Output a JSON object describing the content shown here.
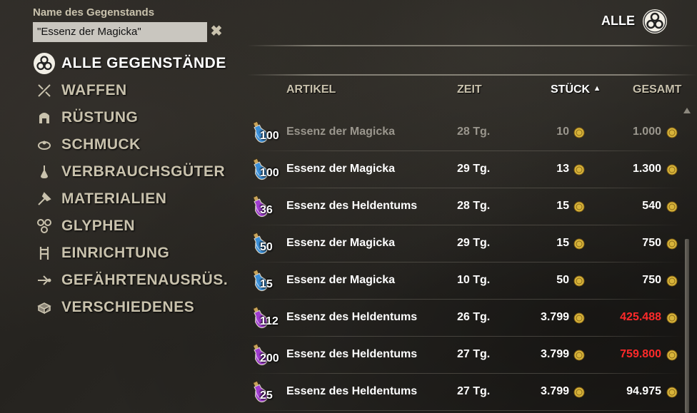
{
  "search": {
    "label": "Name des Gegenstands",
    "value": "\"Essenz der Magicka\"",
    "clear_icon": "close-icon"
  },
  "categories": [
    {
      "label": "ALLE GEGENSTÄNDE",
      "icon": "all-items-icon",
      "active": true
    },
    {
      "label": "WAFFEN",
      "icon": "weapons-icon"
    },
    {
      "label": "RÜSTUNG",
      "icon": "armor-icon"
    },
    {
      "label": "SCHMUCK",
      "icon": "jewelry-icon"
    },
    {
      "label": "VERBRAUCHSGÜTER",
      "icon": "consumables-icon"
    },
    {
      "label": "MATERIALIEN",
      "icon": "materials-icon"
    },
    {
      "label": "GLYPHEN",
      "icon": "glyphs-icon"
    },
    {
      "label": "EINRICHTUNG",
      "icon": "furnishing-icon"
    },
    {
      "label": "GEFÄHRTENAUSRÜS.",
      "icon": "companion-gear-icon"
    },
    {
      "label": "VERSCHIEDENES",
      "icon": "misc-icon"
    }
  ],
  "filter": {
    "label": "ALLE",
    "icon": "all-filter-icon"
  },
  "columns": {
    "item": "ARTIKEL",
    "time": "ZEIT",
    "unit": "STÜCK",
    "unit_sort": "▲",
    "total": "GESAMT"
  },
  "listings": [
    {
      "qty": "100",
      "name": "Essenz der Magicka",
      "time": "28 Tg.",
      "unit": "10",
      "total": "1.000",
      "potion": "blue",
      "dim": true
    },
    {
      "qty": "100",
      "name": "Essenz der Magicka",
      "time": "29 Tg.",
      "unit": "13",
      "total": "1.300",
      "potion": "blue"
    },
    {
      "qty": "36",
      "name": "Essenz des Heldentums",
      "time": "28 Tg.",
      "unit": "15",
      "total": "540",
      "potion": "purple"
    },
    {
      "qty": "50",
      "name": "Essenz der Magicka",
      "time": "29 Tg.",
      "unit": "15",
      "total": "750",
      "potion": "blue"
    },
    {
      "qty": "15",
      "name": "Essenz der Magicka",
      "time": "10 Tg.",
      "unit": "50",
      "total": "750",
      "potion": "blue"
    },
    {
      "qty": "112",
      "name": "Essenz des Heldentums",
      "time": "26 Tg.",
      "unit": "3.799",
      "total": "425.488",
      "potion": "purple",
      "red": true
    },
    {
      "qty": "200",
      "name": "Essenz des Heldentums",
      "time": "27 Tg.",
      "unit": "3.799",
      "total": "759.800",
      "potion": "purple",
      "red": true
    },
    {
      "qty": "25",
      "name": "Essenz des Heldentums",
      "time": "27 Tg.",
      "unit": "3.799",
      "total": "94.975",
      "potion": "purple"
    }
  ],
  "colors": {
    "blue_potion": "#3a8fd8",
    "purple_potion": "#a03bd0",
    "gold": "#d8b43a",
    "over_budget": "#ff2a2a"
  }
}
